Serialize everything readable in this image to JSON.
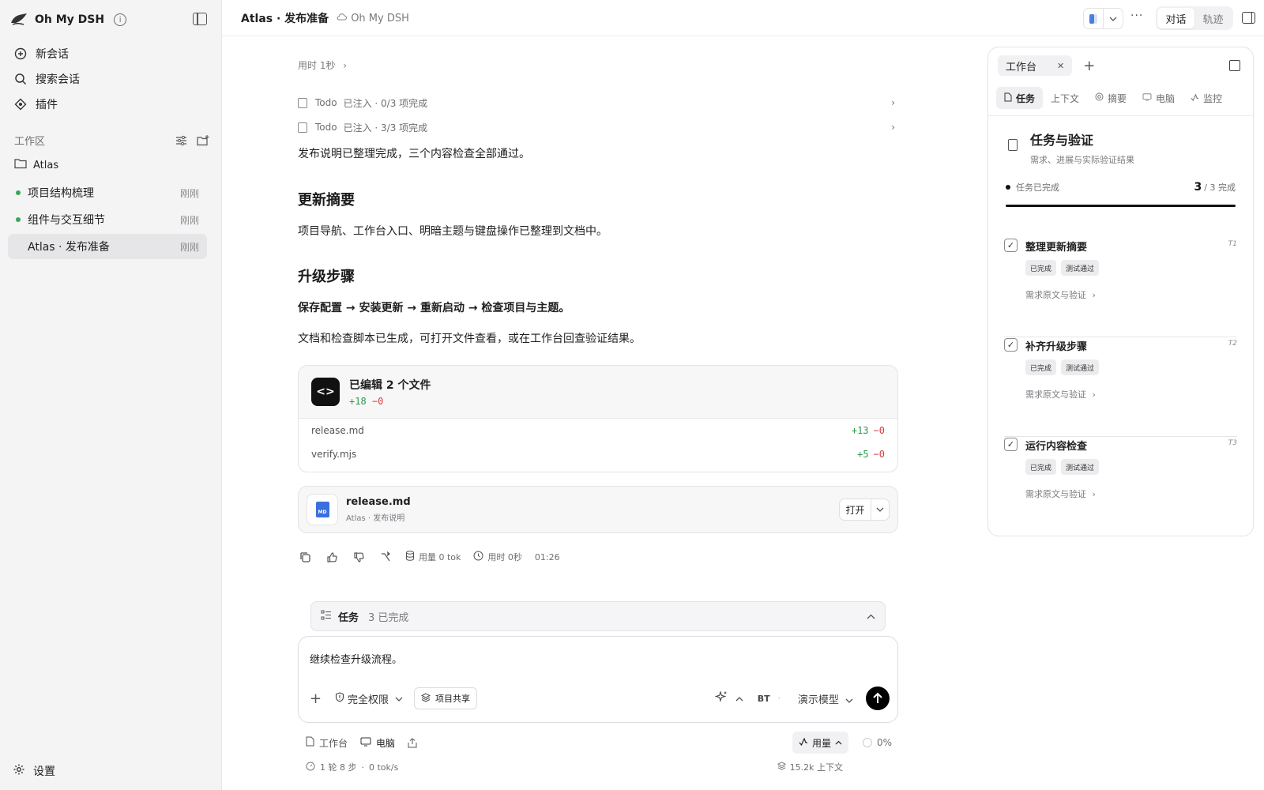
{
  "app": {
    "name": "Oh My DSH",
    "info_icon": "info-icon"
  },
  "nav": [
    {
      "label": "新会话",
      "icon": "plus-circle-icon"
    },
    {
      "label": "搜索会话",
      "icon": "search-icon"
    },
    {
      "label": "插件",
      "icon": "plugin-icon"
    }
  ],
  "workspace": {
    "label": "工作区",
    "folder": "Atlas",
    "sessions": [
      {
        "title": "项目结构梳理",
        "time": "刚刚",
        "dot": true
      },
      {
        "title": "组件与交互细节",
        "time": "刚刚",
        "dot": true
      },
      {
        "title": "Atlas · 发布准备",
        "time": "刚刚",
        "dot": false,
        "active": true
      }
    ]
  },
  "settings": {
    "label": "设置"
  },
  "header": {
    "title": "Atlas · 发布准备",
    "subtitle": "Oh My DSH",
    "more": "···",
    "view_tabs": [
      "对话",
      "轨迹"
    ]
  },
  "chat": {
    "elapsed": "用时 1秒",
    "todos": [
      {
        "name": "Todo",
        "text": "已注入 · 0/3 项完成"
      },
      {
        "name": "Todo",
        "text": "已注入 · 3/3 项完成"
      }
    ],
    "summary_line": "发布说明已整理完成，三个内容检查全部通过。",
    "h_update": "更新摘要",
    "update_text": "项目导航、工作台入口、明暗主题与键盘操作已整理到文档中。",
    "h_steps": "升级步骤",
    "steps_bold": "保存配置 → 安装更新 → 重新启动 → 检查项目与主题。",
    "steps_text": "文档和检查脚本已生成，可打开文件查看，或在工作台回查验证结果。",
    "files_card": {
      "title": "已编辑 2 个文件",
      "add": "+18",
      "del": "−0",
      "files": [
        {
          "name": "release.md",
          "add": "+13",
          "del": "−0"
        },
        {
          "name": "verify.mjs",
          "add": "+5",
          "del": "−0"
        }
      ]
    },
    "attachment": {
      "name": "release.md",
      "sub": "Atlas · 发布说明",
      "badge": "MD",
      "open_label": "打开"
    },
    "actions": {
      "usage": "用量 0 tok",
      "time": "用时 0秒",
      "clock": "01:26"
    }
  },
  "task_bar": {
    "label": "任务",
    "count": "3 已完成"
  },
  "composer": {
    "text": "继续检查升级流程。",
    "permission": "完全权限",
    "share": "项目共享",
    "bt": "BT",
    "model": "演示模型"
  },
  "bottom_bar": {
    "workbench": "工作台",
    "computer": "电脑",
    "usage": "用量",
    "percent": "0%",
    "steps": "1 轮 8 步",
    "speed": "0 tok/s",
    "context": "15.2k 上下文"
  },
  "panel": {
    "tab": "工作台",
    "sub_tabs": [
      "任务",
      "上下文",
      "摘要",
      "电脑",
      "监控"
    ],
    "title": "任务与验证",
    "subtitle": "需求、进展与实际验证结果",
    "progress_label": "任务已完成",
    "progress_done": "3",
    "progress_total": "/ 3 完成",
    "progress_fraction": 1.0,
    "tasks": [
      {
        "title": "整理更新摘要",
        "id": "T1",
        "badges": [
          "已完成",
          "测试通过"
        ],
        "req": "需求原文与验证"
      },
      {
        "title": "补齐升级步骤",
        "id": "T2",
        "badges": [
          "已完成",
          "测试通过"
        ],
        "req": "需求原文与验证"
      },
      {
        "title": "运行内容检查",
        "id": "T3",
        "badges": [
          "已完成",
          "测试通过"
        ],
        "req": "需求原文与验证"
      }
    ]
  }
}
